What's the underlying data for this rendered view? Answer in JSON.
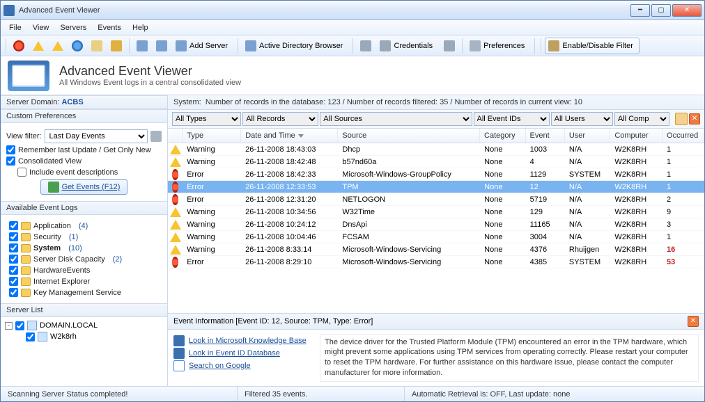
{
  "window": {
    "title": "Advanced Event Viewer"
  },
  "menu": {
    "file": "File",
    "view": "View",
    "servers": "Servers",
    "events": "Events",
    "help": "Help"
  },
  "toolbar": {
    "add_server": "Add Server",
    "adb": "Active Directory Browser",
    "credentials": "Credentials",
    "preferences": "Preferences",
    "filter": "Enable/Disable Filter"
  },
  "banner": {
    "title": "Advanced Event Viewer",
    "subtitle": "All Windows Event logs in a central consolidated view"
  },
  "left": {
    "domain_label": "Server Domain:",
    "domain_value": "ACBS",
    "custom_prefs": "Custom Preferences",
    "view_filter_label": "View filter:",
    "view_filter_value": "Last Day Events",
    "remember": "Remember last Update / Get Only New",
    "consolidated": "Consolidated View",
    "include_desc": "Include event descriptions",
    "get_events": "Get Events   (F12)",
    "available": "Available Event Logs",
    "logs": [
      {
        "name": "Application",
        "count": "(4)",
        "bold": false
      },
      {
        "name": "Security",
        "count": "(1)",
        "bold": false
      },
      {
        "name": "System",
        "count": "(10)",
        "bold": true
      },
      {
        "name": "Server Disk Capacity",
        "count": "(2)",
        "bold": false
      },
      {
        "name": "HardwareEvents",
        "count": "",
        "bold": false
      },
      {
        "name": "Internet Explorer",
        "count": "",
        "bold": false
      },
      {
        "name": "Key Management Service",
        "count": "",
        "bold": false
      }
    ],
    "server_list": "Server List",
    "domain_node": "DOMAIN.LOCAL",
    "server_node": "W2k8rh"
  },
  "system_header": {
    "prefix": "System:",
    "text": "Number of records in the database: 123 / Number of records filtered: 35 / Number of records in current view: 10"
  },
  "filters": {
    "types": "All Types",
    "records": "All Records",
    "sources": "All Sources",
    "eventids": "All Event IDs",
    "users": "All Users",
    "computers": "All Comp"
  },
  "columns": {
    "type": "Type",
    "date": "Date and Time",
    "source": "Source",
    "category": "Category",
    "event": "Event",
    "user": "User",
    "computer": "Computer",
    "occurred": "Occurred"
  },
  "rows": [
    {
      "icon": "warn",
      "type": "Warning",
      "date": "26-11-2008 18:43:03",
      "source": "Dhcp",
      "cat": "None",
      "evt": "1003",
      "user": "N/A",
      "comp": "W2K8RH",
      "occ": "1",
      "occred": false,
      "sel": false
    },
    {
      "icon": "warn",
      "type": "Warning",
      "date": "26-11-2008 18:42:48",
      "source": "b57nd60a",
      "cat": "None",
      "evt": "4",
      "user": "N/A",
      "comp": "W2K8RH",
      "occ": "1",
      "occred": false,
      "sel": false
    },
    {
      "icon": "err",
      "type": "Error",
      "date": "26-11-2008 18:42:33",
      "source": "Microsoft-Windows-GroupPolicy",
      "cat": "None",
      "evt": "1129",
      "user": "SYSTEM",
      "comp": "W2K8RH",
      "occ": "1",
      "occred": false,
      "sel": false
    },
    {
      "icon": "err",
      "type": "Error",
      "date": "26-11-2008 12:33:53",
      "source": "TPM",
      "cat": "None",
      "evt": "12",
      "user": "N/A",
      "comp": "W2K8RH",
      "occ": "1",
      "occred": false,
      "sel": true
    },
    {
      "icon": "err",
      "type": "Error",
      "date": "26-11-2008 12:31:20",
      "source": "NETLOGON",
      "cat": "None",
      "evt": "5719",
      "user": "N/A",
      "comp": "W2K8RH",
      "occ": "2",
      "occred": false,
      "sel": false
    },
    {
      "icon": "warn",
      "type": "Warning",
      "date": "26-11-2008 10:34:56",
      "source": "W32Time",
      "cat": "None",
      "evt": "129",
      "user": "N/A",
      "comp": "W2K8RH",
      "occ": "9",
      "occred": false,
      "sel": false
    },
    {
      "icon": "warn",
      "type": "Warning",
      "date": "26-11-2008 10:24:12",
      "source": "DnsApi",
      "cat": "None",
      "evt": "11165",
      "user": "N/A",
      "comp": "W2K8RH",
      "occ": "3",
      "occred": false,
      "sel": false
    },
    {
      "icon": "warn",
      "type": "Warning",
      "date": "26-11-2008 10:04:46",
      "source": "FCSAM",
      "cat": "None",
      "evt": "3004",
      "user": "N/A",
      "comp": "W2K8RH",
      "occ": "1",
      "occred": false,
      "sel": false
    },
    {
      "icon": "warn",
      "type": "Warning",
      "date": "26-11-2008 8:33:14",
      "source": "Microsoft-Windows-Servicing",
      "cat": "None",
      "evt": "4376",
      "user": "Rhuijgen",
      "comp": "W2K8RH",
      "occ": "16",
      "occred": true,
      "sel": false
    },
    {
      "icon": "err",
      "type": "Error",
      "date": "26-11-2008 8:29:10",
      "source": "Microsoft-Windows-Servicing",
      "cat": "None",
      "evt": "4385",
      "user": "SYSTEM",
      "comp": "W2K8RH",
      "occ": "53",
      "occred": true,
      "sel": false
    }
  ],
  "event_info": {
    "header": "Event Information [Event ID: 12, Source: TPM, Type: Error]",
    "link_mskb": "Look in Microsoft Knowledge Base",
    "link_eid": "Look in Event ID Database",
    "link_google": "Search on Google",
    "description": "The device driver for the Trusted Platform Module (TPM) encountered an error in the TPM hardware, which might prevent some applications using TPM services from operating correctly.  Please restart your computer to reset the TPM hardware.  For further assistance on this hardware issue, please contact the computer manufacturer for more information."
  },
  "status": {
    "left": "Scanning Server Status completed!",
    "mid": "Filtered 35 events.",
    "right": "Automatic Retrieval is: OFF, Last update: none"
  }
}
